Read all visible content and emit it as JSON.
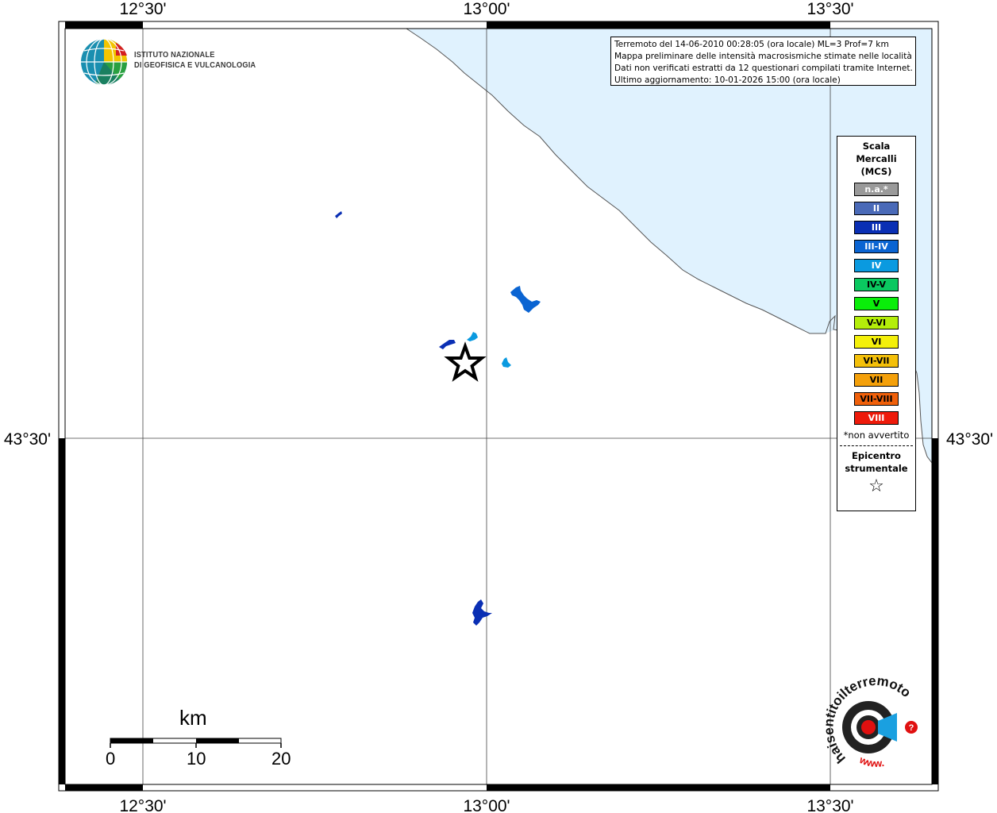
{
  "info_box": {
    "lines": [
      "Terremoto del 14-06-2010 00:28:05 (ora locale) ML=3 Prof=7 km",
      "Mappa preliminare delle intensità macrosismiche stimate nelle località",
      "Dati non verificati estratti da 12 questionari compilati tramite Internet.",
      "Ultimo aggiornamento: 10-01-2026 15:00 (ora locale)"
    ]
  },
  "logo": {
    "line1": "ISTITUTO NAZIONALE",
    "line2": "DI GEOFISICA E VULCANOLOGIA"
  },
  "coords": {
    "lon": [
      "12°30'",
      "13°00'",
      "13°30'"
    ],
    "lat": [
      "43°30'"
    ]
  },
  "legend": {
    "title_lines": [
      "Scala",
      "Mercalli",
      "(MCS)"
    ],
    "items": [
      {
        "label": "n.a.*",
        "color": "#9a9a9a",
        "text_color": "#ffffff"
      },
      {
        "label": "II",
        "color": "#4a6ab8",
        "text_color": "#ffffff"
      },
      {
        "label": "III",
        "color": "#0a2fb4",
        "text_color": "#ffffff"
      },
      {
        "label": "III-IV",
        "color": "#0a64d2",
        "text_color": "#ffffff"
      },
      {
        "label": "IV",
        "color": "#0a9ae0",
        "text_color": "#ffffff"
      },
      {
        "label": "IV-V",
        "color": "#0ac860",
        "text_color": "#000000"
      },
      {
        "label": "V",
        "color": "#0aee0a",
        "text_color": "#000000"
      },
      {
        "label": "V-VI",
        "color": "#b4ee0a",
        "text_color": "#000000"
      },
      {
        "label": "VI",
        "color": "#f4f00a",
        "text_color": "#000000"
      },
      {
        "label": "VI-VII",
        "color": "#f4c00a",
        "text_color": "#000000"
      },
      {
        "label": "VII",
        "color": "#f4a00a",
        "text_color": "#000000"
      },
      {
        "label": "VII-VIII",
        "color": "#f0600a",
        "text_color": "#000000"
      },
      {
        "label": "VIII",
        "color": "#ee1a0a",
        "text_color": "#ffffff"
      }
    ],
    "note": "*non avvertito",
    "epicenter_lines": [
      "Epicentro",
      "strumentale"
    ],
    "epicenter_symbol": "☆"
  },
  "scale_bar": {
    "title": "km",
    "labels": [
      "0",
      "10",
      "20"
    ]
  },
  "hsit_logo": {
    "text": "haisentitoilterremoto.it",
    "www": "www.",
    "q": "?"
  },
  "colors": {
    "sea": "#e0f2fe",
    "coast": "#555555",
    "epicenter": "#000000"
  }
}
